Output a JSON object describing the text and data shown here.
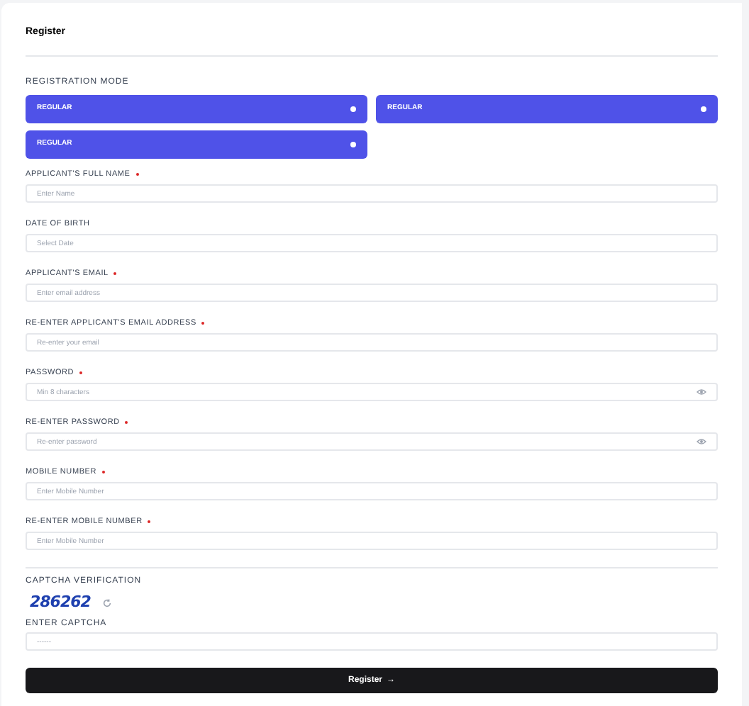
{
  "title": "Register",
  "registration_mode": {
    "label": "REGISTRATION MODE",
    "options": [
      {
        "label": "REGULAR",
        "selected": false
      },
      {
        "label": "REGULAR",
        "selected": false
      },
      {
        "label": "REGULAR",
        "selected": false
      }
    ]
  },
  "fields": [
    {
      "label": "APPLICANT'S FULL NAME",
      "required": true,
      "placeholder": "Enter Name",
      "kind": "text"
    },
    {
      "label": "DATE OF BIRTH",
      "required": false,
      "placeholder": "Select Date",
      "kind": "text"
    },
    {
      "label": "APPLICANT'S EMAIL",
      "required": true,
      "placeholder": "Enter email address",
      "kind": "text"
    },
    {
      "label": "RE-ENTER APPLICANT'S EMAIL ADDRESS",
      "required": true,
      "placeholder": "Re-enter your email",
      "kind": "text"
    },
    {
      "label": "PASSWORD",
      "required": true,
      "placeholder": "Min 8 characters",
      "kind": "password"
    },
    {
      "label": "RE-ENTER PASSWORD",
      "required": true,
      "placeholder": "Re-enter password",
      "kind": "password"
    },
    {
      "label": "MOBILE NUMBER",
      "required": true,
      "placeholder": "Enter Mobile Number",
      "kind": "text"
    },
    {
      "label": "RE-ENTER MOBILE NUMBER",
      "required": true,
      "placeholder": "Enter Mobile Number",
      "kind": "text"
    }
  ],
  "captcha": {
    "label": "CAPTCHA VERIFICATION",
    "code": "286262",
    "input_label": "ENTER CAPTCHA",
    "placeholder": "------"
  },
  "submit": {
    "label": "Register",
    "arrow": "→"
  }
}
